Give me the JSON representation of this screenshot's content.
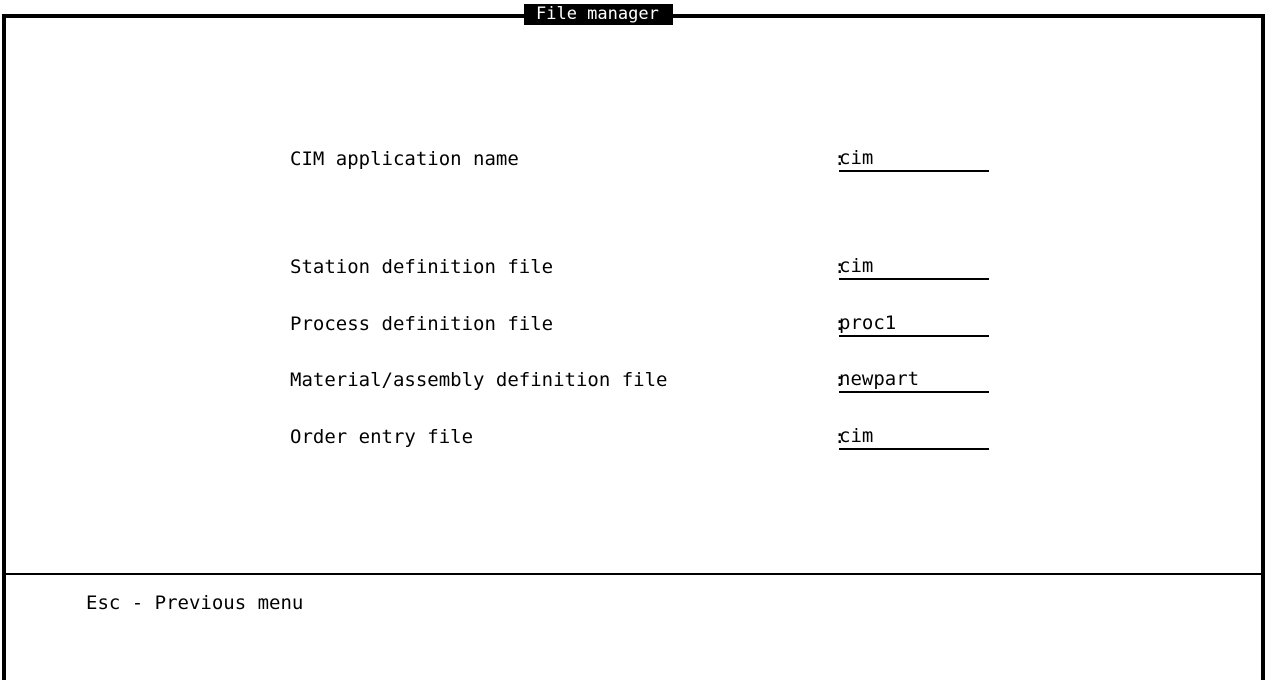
{
  "window": {
    "title": "File manager"
  },
  "fields": [
    {
      "label": "CIM application name",
      "value": "cim"
    },
    {
      "label": "Station definition file",
      "value": "cim"
    },
    {
      "label": "Process definition file",
      "value": "proc1"
    },
    {
      "label": "Material/assembly definition file",
      "value": "newpart"
    },
    {
      "label": "Order entry file",
      "value": "cim"
    }
  ],
  "separator": ":",
  "footer": {
    "hint": "Esc - Previous menu"
  }
}
